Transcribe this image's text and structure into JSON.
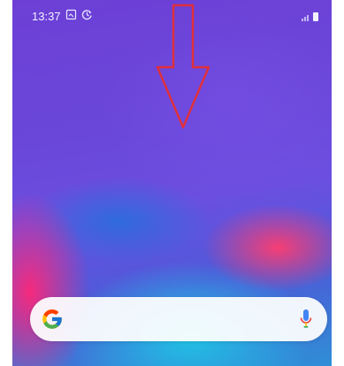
{
  "status_bar": {
    "time": "13:37",
    "icons": [
      "screenshot-icon",
      "clock-sync-icon",
      "signal-icon",
      "battery-icon"
    ]
  },
  "wallpaper": {
    "colors": [
      "#6d3fd6",
      "#4d5ad8",
      "#2f8fd6",
      "#ff3c6e",
      "#1ec8e6"
    ]
  },
  "overlay": {
    "arrow_direction": "down",
    "arrow_color": "#e0303a"
  },
  "search_widget": {
    "logo": "google-logo",
    "mic_icon": "microphone-icon"
  }
}
